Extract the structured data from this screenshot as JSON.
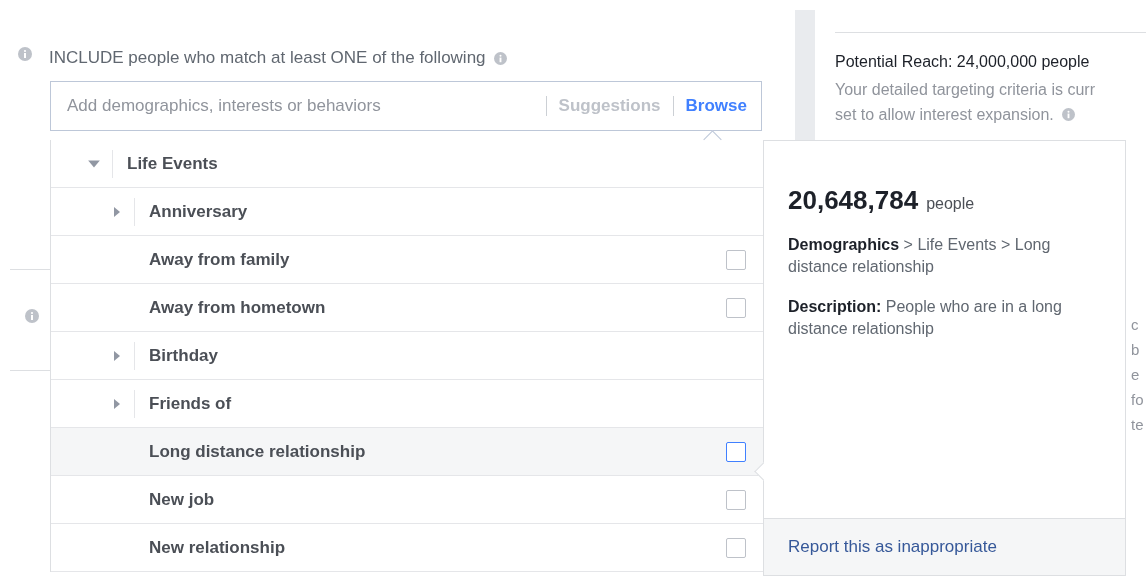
{
  "include": {
    "label": "INCLUDE people who match at least ONE of the following"
  },
  "search": {
    "placeholder": "Add demographics, interests or behaviors",
    "tabs": [
      {
        "label": "Suggestions",
        "selected": false
      },
      {
        "label": "Browse",
        "selected": true
      }
    ]
  },
  "browse": {
    "category": {
      "label": "Life Events",
      "expanded": true
    },
    "items": [
      {
        "kind": "branch",
        "label": "Anniversary",
        "expanded": false
      },
      {
        "kind": "option",
        "label": "Away from family",
        "checked": false,
        "selected": false
      },
      {
        "kind": "option",
        "label": "Away from hometown",
        "checked": false,
        "selected": false
      },
      {
        "kind": "branch",
        "label": "Birthday",
        "expanded": false
      },
      {
        "kind": "branch",
        "label": "Friends of",
        "expanded": false
      },
      {
        "kind": "option",
        "label": "Long distance relationship",
        "checked": false,
        "selected": true
      },
      {
        "kind": "option",
        "label": "New job",
        "checked": false,
        "selected": false
      },
      {
        "kind": "option",
        "label": "New relationship",
        "checked": false,
        "selected": false
      }
    ]
  },
  "detail": {
    "count": "20,648,784",
    "unit": "people",
    "path": "**Demographics** > Life Events > Long distance relationship",
    "description": "**Description:** People who are in a long distance relationship",
    "report_link": "Report this as inappropriate"
  },
  "reach": {
    "title": "Potential Reach: 24,000,000 people",
    "note_lines": [
      "Your detailed targeting criteria is curr",
      "set to allow interest expansion."
    ],
    "cut_lines": [
      "c",
      "b",
      "e",
      "fo",
      "te"
    ]
  }
}
